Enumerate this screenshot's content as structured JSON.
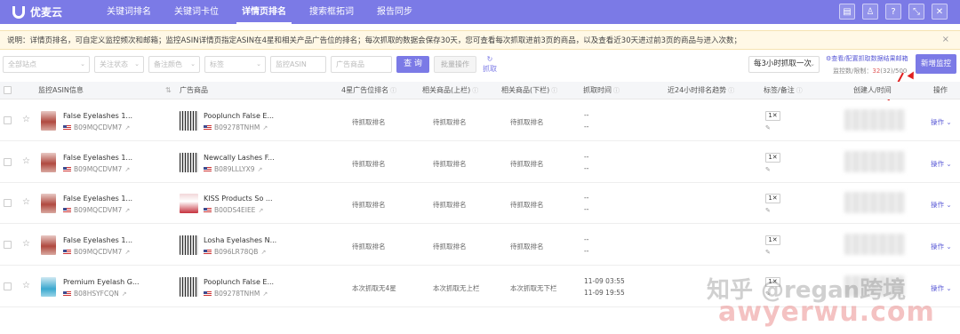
{
  "brand": {
    "name": "优麦云"
  },
  "nav": {
    "items": [
      "关键词排名",
      "关键词卡位",
      "详情页排名",
      "搜索框拓词",
      "报告同步"
    ],
    "active": 2,
    "icons": [
      "doc-icon",
      "user-icon",
      "help-icon",
      "collapse-icon",
      "close-icon"
    ]
  },
  "notice": {
    "text": "说明：详情页排名，可自定义监控频次和邮箱；监控ASIN详情页指定ASIN在4星和相关产品广告位的排名；每次抓取的数据会保存30天，您可查看每次抓取进前3页的商品，以及查看近30天进过前3页的商品与进入次数；",
    "close": "×"
  },
  "filters": {
    "site": "全部站点",
    "follow": "关注状态",
    "remark_color": "备注颜色",
    "tag": "标签",
    "monitor_asin_placeholder": "监控ASIN",
    "ad_product_placeholder": "广告商品",
    "query_label": "查 询",
    "batch_label": "批量操作",
    "refresh_label": "抓取",
    "frequency": "每3小时抓取一次",
    "config_link": "查看/配置抓取数据结果邮箱",
    "quota_prefix": "监控数/限制：",
    "quota_used": "32",
    "quota_paren": "(32)",
    "quota_limit": "/500",
    "new_button": "新增监控"
  },
  "table": {
    "headers": [
      "监控ASIN信息",
      "广告商品",
      "4星广告位排名",
      "相关商品(上栏)",
      "相关商品(下栏)",
      "抓取时间",
      "近24小时排名趋势",
      "标签/备注",
      "创建人/时间",
      "操作"
    ],
    "rows": [
      {
        "title": "False Eyelashes 1...",
        "asin": "B09MQCDVM7",
        "ad_title": "Pooplunch False E...",
        "ad_asin": "B09278TNHM",
        "r4": "待抓取排名",
        "ru": "待抓取排名",
        "rl": "待抓取排名",
        "time1": "--",
        "time2": "--",
        "tag": "1",
        "op": "操作"
      },
      {
        "title": "False Eyelashes 1...",
        "asin": "B09MQCDVM7",
        "ad_title": "Newcally Lashes F...",
        "ad_asin": "B089LLLYX9",
        "r4": "待抓取排名",
        "ru": "待抓取排名",
        "rl": "待抓取排名",
        "time1": "--",
        "time2": "--",
        "tag": "1",
        "op": "操作"
      },
      {
        "title": "False Eyelashes 1...",
        "asin": "B09MQCDVM7",
        "ad_title": "KISS Products So ...",
        "ad_asin": "B00DS4EIEE",
        "r4": "待抓取排名",
        "ru": "待抓取排名",
        "rl": "待抓取排名",
        "time1": "--",
        "time2": "--",
        "tag": "1",
        "op": "操作"
      },
      {
        "title": "False Eyelashes 1...",
        "asin": "B09MQCDVM7",
        "ad_title": "Losha Eyelashes N...",
        "ad_asin": "B096LR78QB",
        "r4": "待抓取排名",
        "ru": "待抓取排名",
        "rl": "待抓取排名",
        "time1": "--",
        "time2": "--",
        "tag": "1",
        "op": "操作"
      },
      {
        "title": "Premium Eyelash G...",
        "asin": "B08HSYFCQN",
        "ad_title": "Pooplunch False E...",
        "ad_asin": "B09278TNHM",
        "r4": "本次抓取无4星",
        "ru": "本次抓取无上栏",
        "rl": "本次抓取无下栏",
        "time1": "11-09 03:55",
        "time2": "11-09 19:55",
        "tag": "1",
        "op": "操作"
      }
    ]
  },
  "watermark": {
    "line1": "知乎 @regan跨境",
    "line2": "awyerwu.com"
  },
  "colors": {
    "primary": "#7b7ae6",
    "link": "#5a5ad6",
    "notice_bg": "#fff8e6",
    "annotation": "#e02020"
  }
}
